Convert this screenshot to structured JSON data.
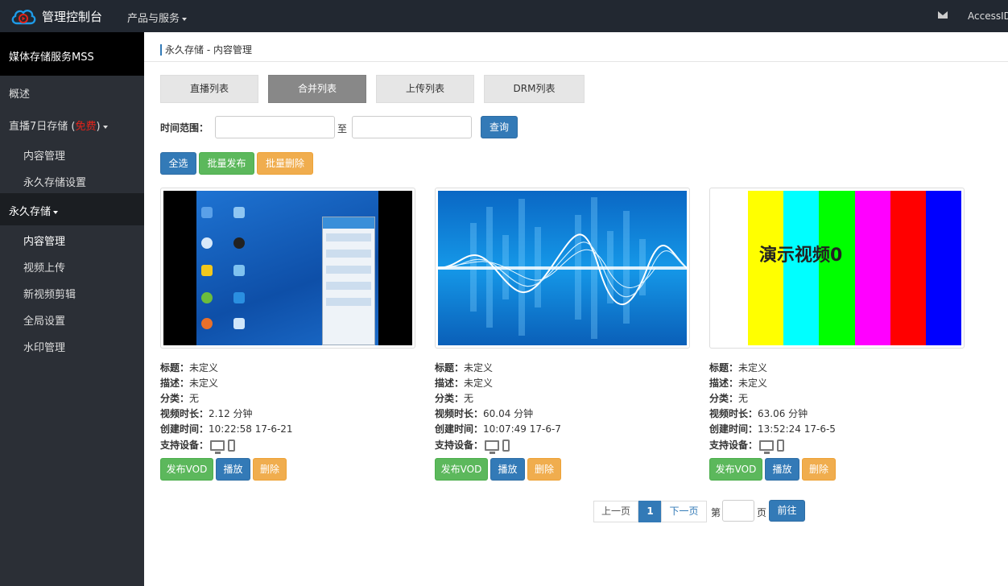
{
  "topbar": {
    "title": "管理控制台",
    "products_menu": "产品与服务",
    "accessid": "AccessID"
  },
  "sidebar": {
    "title": "媒体存储服务MSS",
    "overview": "概述",
    "live7_label": "直播7日存储 (",
    "live7_free": "免费",
    "live7_close": ")",
    "live7_content": "内容管理",
    "live7_perm_settings": "永久存储设置",
    "permanent": "永久存储",
    "perm_items": [
      "内容管理",
      "视频上传",
      "新视频剪辑",
      "全局设置",
      "水印管理"
    ]
  },
  "breadcrumb": "永久存储 - 内容管理",
  "tabs": [
    "直播列表",
    "合并列表",
    "上传列表",
    "DRM列表"
  ],
  "filter": {
    "range_label": "时间范围：",
    "to_label": "至",
    "query_button": "查询"
  },
  "bulk": {
    "select_all": "全选",
    "batch_publish": "批量发布",
    "batch_delete": "批量删除"
  },
  "labels": {
    "title": "标题：",
    "desc": "描述：",
    "category": "分类：",
    "duration": "视频时长：",
    "created": "创建时间：",
    "devices": "支持设备："
  },
  "card_actions": {
    "publish": "发布VOD",
    "play": "播放",
    "delete": "删除"
  },
  "cards": [
    {
      "title": "未定义",
      "desc": "未定义",
      "category": "无",
      "duration": "2.12 分钟",
      "created": "10:22:58 17-6-21"
    },
    {
      "title": "未定义",
      "desc": "未定义",
      "category": "无",
      "duration": "60.04 分钟",
      "created": "10:07:49 17-6-7"
    },
    {
      "title": "未定义",
      "desc": "未定义",
      "category": "无",
      "duration": "63.06 分钟",
      "created": "13:52:24 17-6-5"
    }
  ],
  "demo_video_text": "演示视频0",
  "colors_bars": [
    "#ffff00",
    "#00ffff",
    "#00ff00",
    "#ff00ff",
    "#ff0000",
    "#0000ff"
  ],
  "pagination": {
    "prev": "上一页",
    "current": "1",
    "next": "下一页",
    "page_prefix": "第",
    "page_suffix": "页",
    "go": "前往"
  },
  "accent": "#337ab7"
}
